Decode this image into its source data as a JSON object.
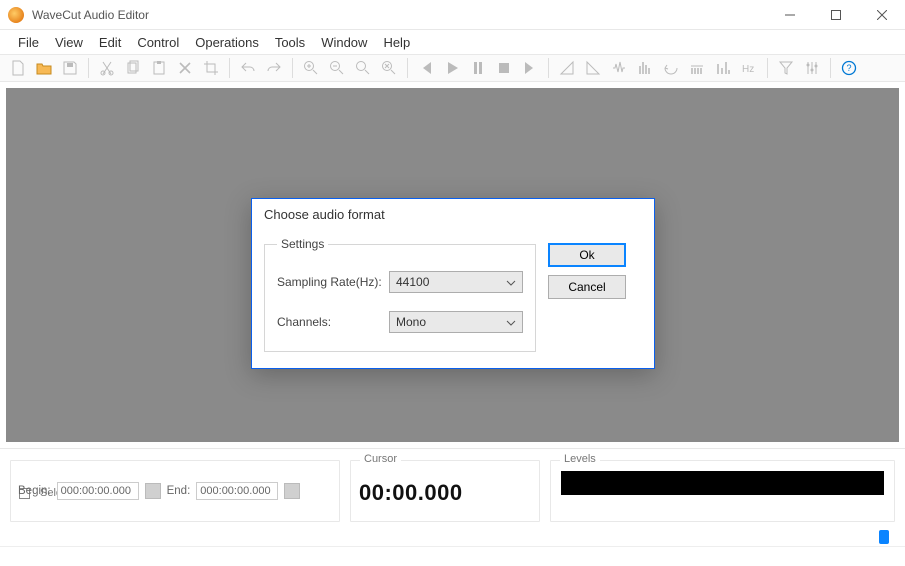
{
  "titlebar": {
    "title": "WaveCut Audio Editor"
  },
  "menu": {
    "file": "File",
    "view": "View",
    "edit": "Edit",
    "control": "Control",
    "operations": "Operations",
    "tools": "Tools",
    "window": "Window",
    "help": "Help"
  },
  "status": {
    "selection": {
      "title": "Selection",
      "begin_label": "Begin:",
      "begin_value": "000:00:00.000",
      "end_label": "End:",
      "end_value": "000:00:00.000"
    },
    "cursor": {
      "title": "Cursor",
      "value": "00:00.000"
    },
    "levels": {
      "title": "Levels"
    }
  },
  "dialog": {
    "title": "Choose audio format",
    "fieldset_label": "Settings",
    "sampling_label": "Sampling Rate(Hz):",
    "sampling_value": "44100",
    "channels_label": "Channels:",
    "channels_value": "Mono",
    "ok_label": "Ok",
    "cancel_label": "Cancel"
  }
}
